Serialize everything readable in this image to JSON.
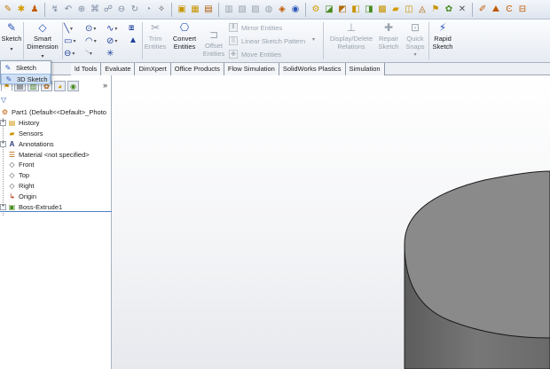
{
  "top_toolbar": {
    "icons": [
      "new-icon",
      "open-icon",
      "save-icon",
      "print-icon",
      "undo-icon",
      "redo-icon",
      "rebuild-icon",
      "options-icon",
      "sketch-grid-icon",
      "line-icon",
      "circle-icon",
      "arc-icon",
      "select-icon",
      "view-icon",
      "box-icon",
      "box2-icon",
      "zoom-icon",
      "pan-icon",
      "rotate-icon",
      "section-icon",
      "color-icon",
      "appearance-icon",
      "scene-icon",
      "smart-dim-icon",
      "sketch-tool-icon",
      "relation-icon",
      "feature-icon",
      "folder-icon",
      "note-icon",
      "layer-icon",
      "flag-icon",
      "star-icon",
      "settings-icon",
      "arrow-icon",
      "fill-icon",
      "c-icon",
      "paint-icon"
    ]
  },
  "ribbon": {
    "sketch": "Sketch",
    "smart_dimension": "Smart\nDimension",
    "trim_entities": "Trim\nEntities",
    "convert_entities": "Convert\nEntities",
    "offset_entities": "Offset\nEntities",
    "mirror_entities": "Mirror Entities",
    "linear_sketch_pattern": "Linear Sketch Pattern",
    "move_entities": "Move Entities",
    "display_delete_relations": "Display/Delete\nRelations",
    "repair_sketch": "Repair\nSketch",
    "quick_snaps": "Quick\nSnaps",
    "rapid_sketch": "Rapid\nSketch"
  },
  "dropdown": {
    "items": [
      {
        "label": "Sketch"
      },
      {
        "label": "3D Sketch"
      }
    ]
  },
  "tabs": [
    "ld Tools",
    "Evaluate",
    "DimXpert",
    "Office Products",
    "Flow Simulation",
    "SolidWorks Plastics",
    "Simulation"
  ],
  "feature_tree": {
    "expand_glyph": "»",
    "root": "Part1  (Default<<Default>_Photo",
    "nodes": [
      {
        "label": "History"
      },
      {
        "label": "Sensors"
      },
      {
        "label": "Annotations"
      },
      {
        "label": "Material <not specified>"
      },
      {
        "label": "Front"
      },
      {
        "label": "Top"
      },
      {
        "label": "Right"
      },
      {
        "label": "Origin"
      },
      {
        "label": "Boss-Extrude1"
      }
    ]
  },
  "colors": {
    "accent": "#4d7fc8",
    "cylinder_fill": "#6e6e6e",
    "cylinder_top": "#8d8d8d"
  }
}
